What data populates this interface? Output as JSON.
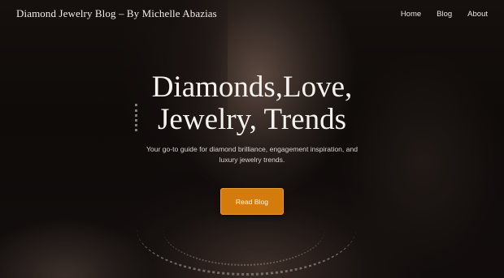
{
  "header": {
    "brand": "Diamond Jewelry Blog – By Michelle Abazias",
    "nav": [
      "Home",
      "Blog",
      "About"
    ]
  },
  "hero": {
    "headline_line1": "Diamonds,Love,",
    "headline_line2": "Jewelry, Trends",
    "subtitle_line1": "Your go-to guide for diamond brilliance, engagement inspiration, and",
    "subtitle_line2": "luxury jewelry trends.",
    "cta_label": "Read Blog"
  },
  "colors": {
    "accent": "#d37b0c",
    "background": "#120e0c",
    "text": "#f6f2ee"
  }
}
